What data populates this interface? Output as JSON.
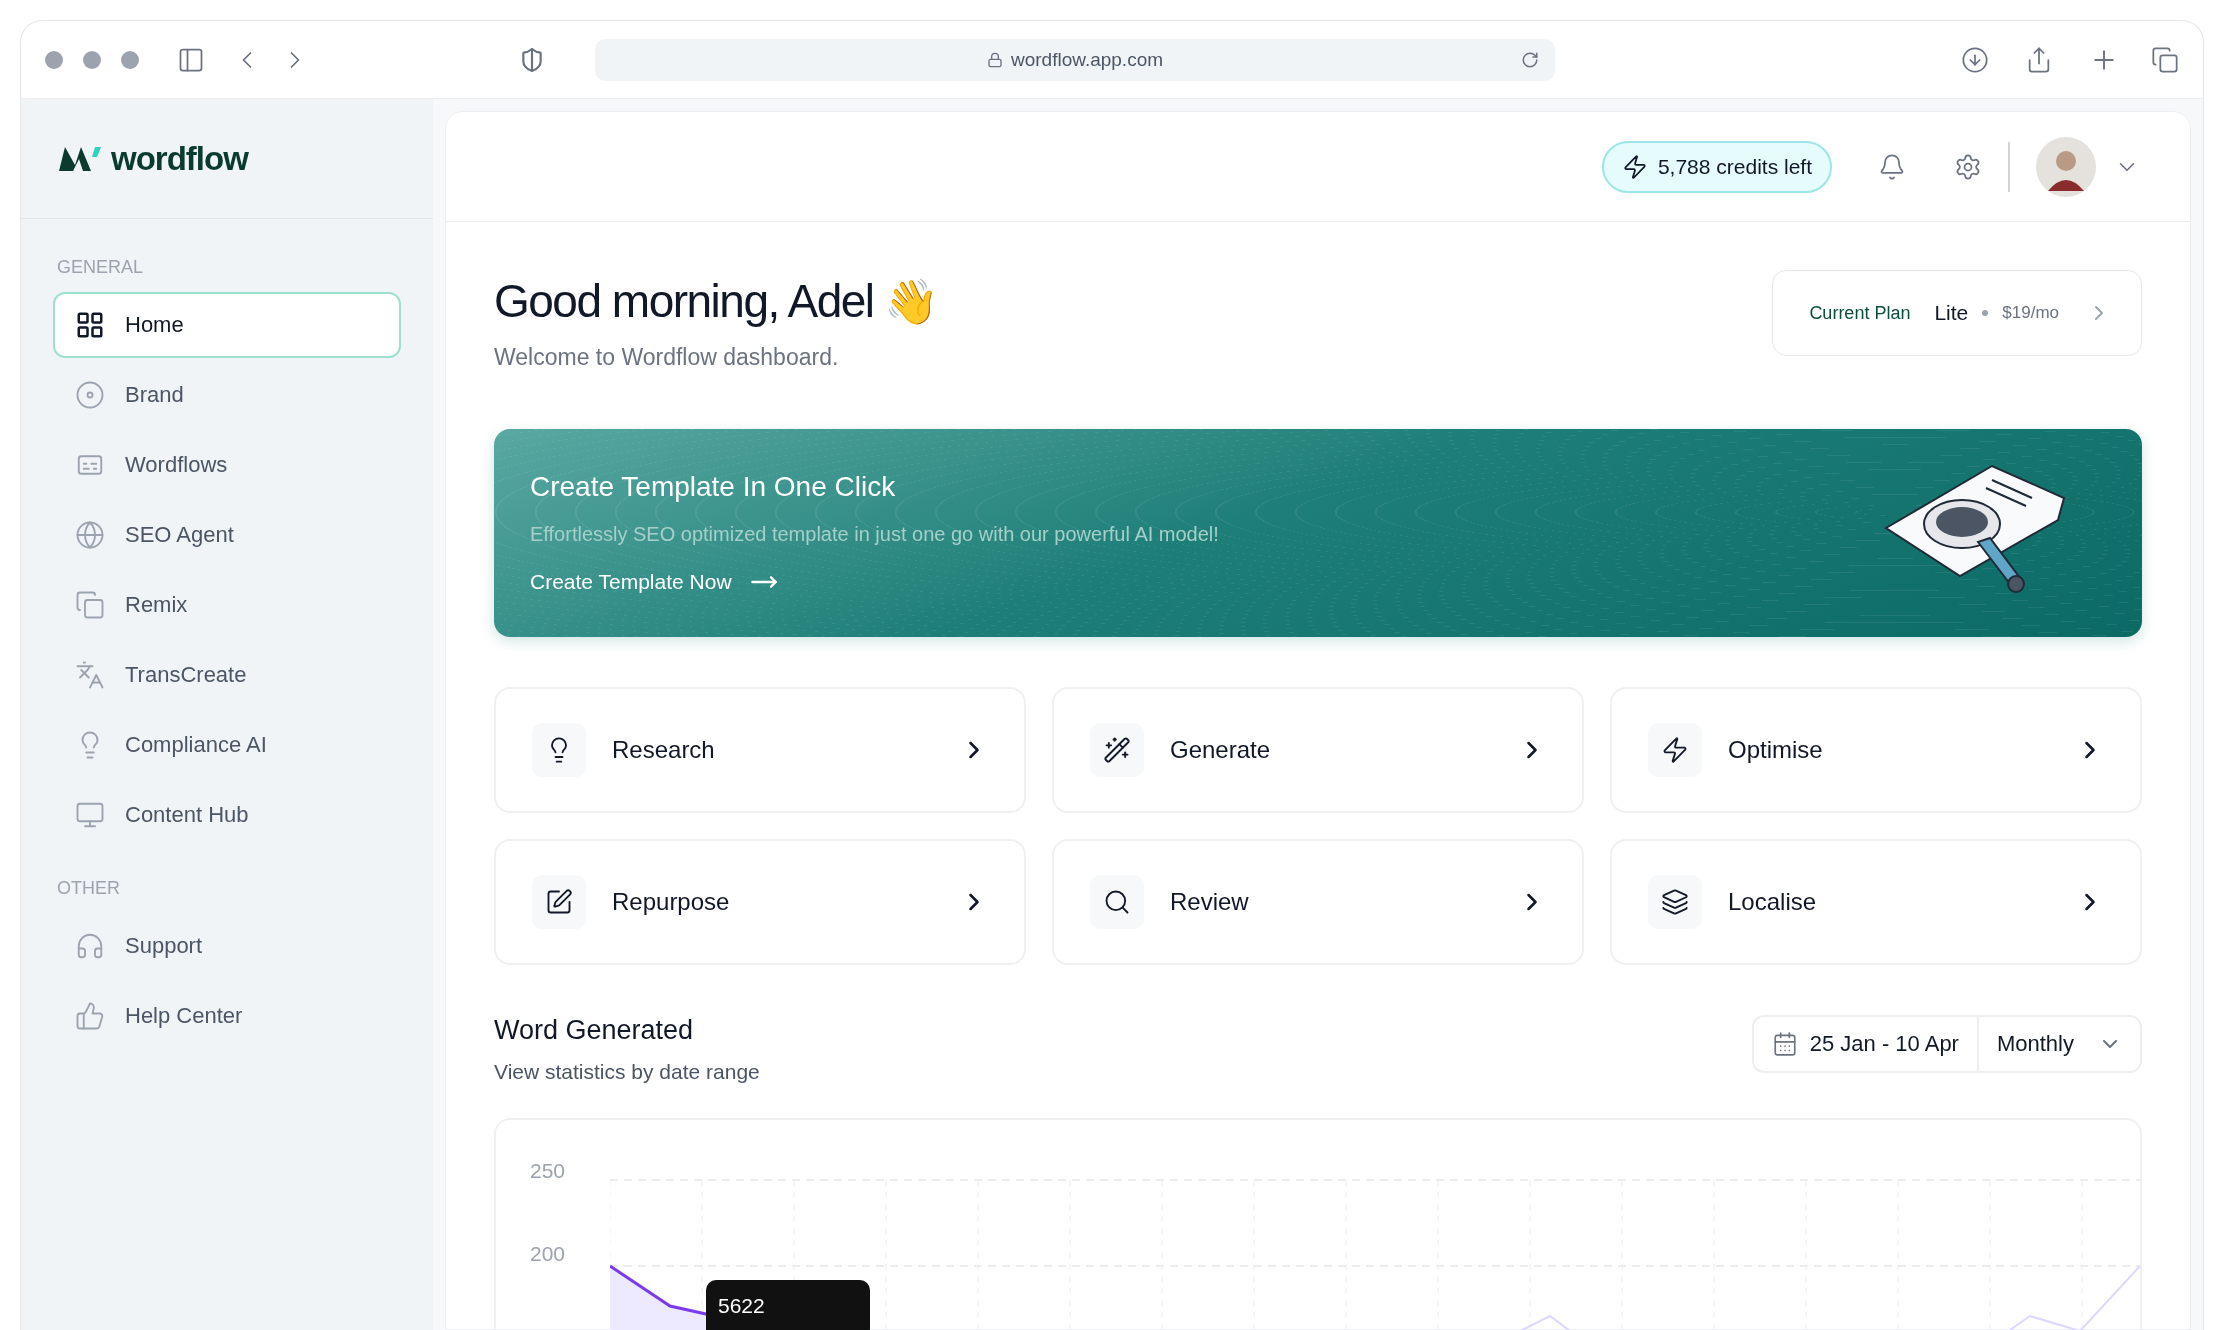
{
  "browser": {
    "url": "wordflow.app.com"
  },
  "sidebar": {
    "logo": "wordflow",
    "sections": [
      {
        "heading": "GENERAL",
        "items": [
          {
            "label": "Home",
            "selected": true
          },
          {
            "label": "Brand",
            "selected": false
          },
          {
            "label": "Wordflows",
            "selected": false
          },
          {
            "label": "SEO Agent",
            "selected": false
          },
          {
            "label": "Remix",
            "selected": false
          },
          {
            "label": "TransCreate",
            "selected": false
          },
          {
            "label": "Compliance AI",
            "selected": false
          },
          {
            "label": "Content Hub",
            "selected": false
          }
        ]
      },
      {
        "heading": "OTHER",
        "items": [
          {
            "label": "Support",
            "selected": false
          },
          {
            "label": "Help Center",
            "selected": false
          }
        ]
      }
    ]
  },
  "header": {
    "credits": "5,788 credits left"
  },
  "greeting": {
    "title": "Good morning, Adel",
    "emoji": "👋",
    "subtitle": "Welcome to Wordflow dashboard."
  },
  "plan": {
    "label": "Current Plan",
    "name": "Lite",
    "price": "$19/mo"
  },
  "banner": {
    "title": "Create Template In One Click",
    "text": "Effortlessly SEO optimized template in just one go with our powerful AI model!",
    "action": "Create Template Now"
  },
  "actions": [
    "Research",
    "Generate",
    "Optimise",
    "Repurpose",
    "Review",
    "Localise"
  ],
  "stats": {
    "title": "Word Generated",
    "subtitle": "View statistics by date range",
    "date_range": "25 Jan - 10 Apr",
    "period": "Monthly",
    "y_labels": [
      "250",
      "200"
    ],
    "tooltip": "5622"
  }
}
